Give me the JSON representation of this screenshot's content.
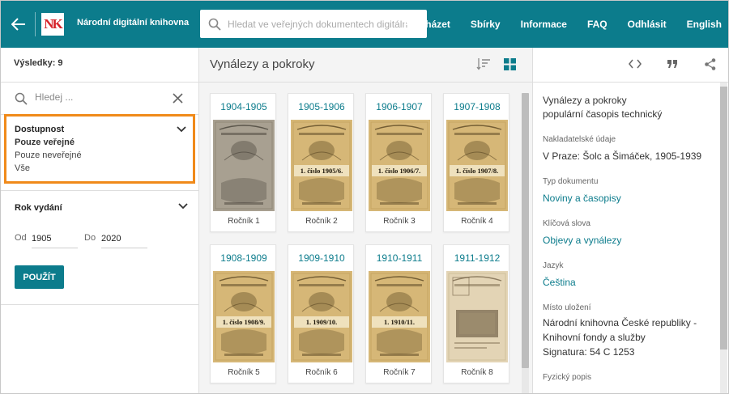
{
  "header": {
    "logo_text": "NK",
    "brand": "Národní digitální knihovna",
    "search_placeholder": "Hledat ve veřejných dokumentech digitáln",
    "nav": [
      "Procházet",
      "Sbírky",
      "Informace",
      "FAQ",
      "Odhlásit",
      "English"
    ],
    "brand_color": "#0c7c8c",
    "logo_color": "#d6232a"
  },
  "filters": {
    "results_label": "Výsledky: 9",
    "search_placeholder": "Hledej ...",
    "access": {
      "title": "Dostupnost",
      "options": [
        "Pouze veřejné",
        "Pouze neveřejné",
        "Vše"
      ],
      "highlight_color": "#f08a1a"
    },
    "year": {
      "title": "Rok vydání",
      "from_label": "Od",
      "from_value": "1905",
      "to_label": "Do",
      "to_value": "2020",
      "apply_label": "POUŽÍT"
    }
  },
  "center": {
    "title": "Vynálezy a pokroky",
    "cards": [
      {
        "year": "1904-1905",
        "label": "Ročník 1",
        "thumb": "gray",
        "banner": ""
      },
      {
        "year": "1905-1906",
        "label": "Ročník 2",
        "thumb": "sepia",
        "banner": "1. číslo 1905/6."
      },
      {
        "year": "1906-1907",
        "label": "Ročník 3",
        "thumb": "sepia",
        "banner": "1. číslo 1906/7."
      },
      {
        "year": "1907-1908",
        "label": "Ročník 4",
        "thumb": "sepia",
        "banner": "1. číslo 1907/8."
      },
      {
        "year": "1908-1909",
        "label": "Ročník 5",
        "thumb": "sepia",
        "banner": "1. číslo 1908/9."
      },
      {
        "year": "1909-1910",
        "label": "Ročník 6",
        "thumb": "sepia",
        "banner": "1. 1909/10."
      },
      {
        "year": "1910-1911",
        "label": "Ročník 7",
        "thumb": "sepia",
        "banner": "1. 1910/11."
      },
      {
        "year": "1911-1912",
        "label": "Ročník 8",
        "thumb": "pale",
        "banner": ""
      }
    ]
  },
  "detail": {
    "title": "Vynálezy a pokroky",
    "subtitle": "populární časopis technický",
    "fields": [
      {
        "label": "Nakladatelské údaje",
        "values": [
          "V Praze: Šolc a Šimáček, 1905-1939"
        ],
        "link": false
      },
      {
        "label": "Typ dokumentu",
        "values": [
          "Noviny a časopisy"
        ],
        "link": true
      },
      {
        "label": "Klíčová slova",
        "values": [
          "Objevy a vynálezy"
        ],
        "link": true
      },
      {
        "label": "Jazyk",
        "values": [
          "Čeština"
        ],
        "link": true
      },
      {
        "label": "Místo uložení",
        "values": [
          "Národní knihovna České republiky -",
          "Knihovní fondy a služby",
          "Signatura: 54 C 1253"
        ],
        "link": false
      },
      {
        "label": "Fyzický popis",
        "values": [],
        "link": false
      }
    ]
  }
}
